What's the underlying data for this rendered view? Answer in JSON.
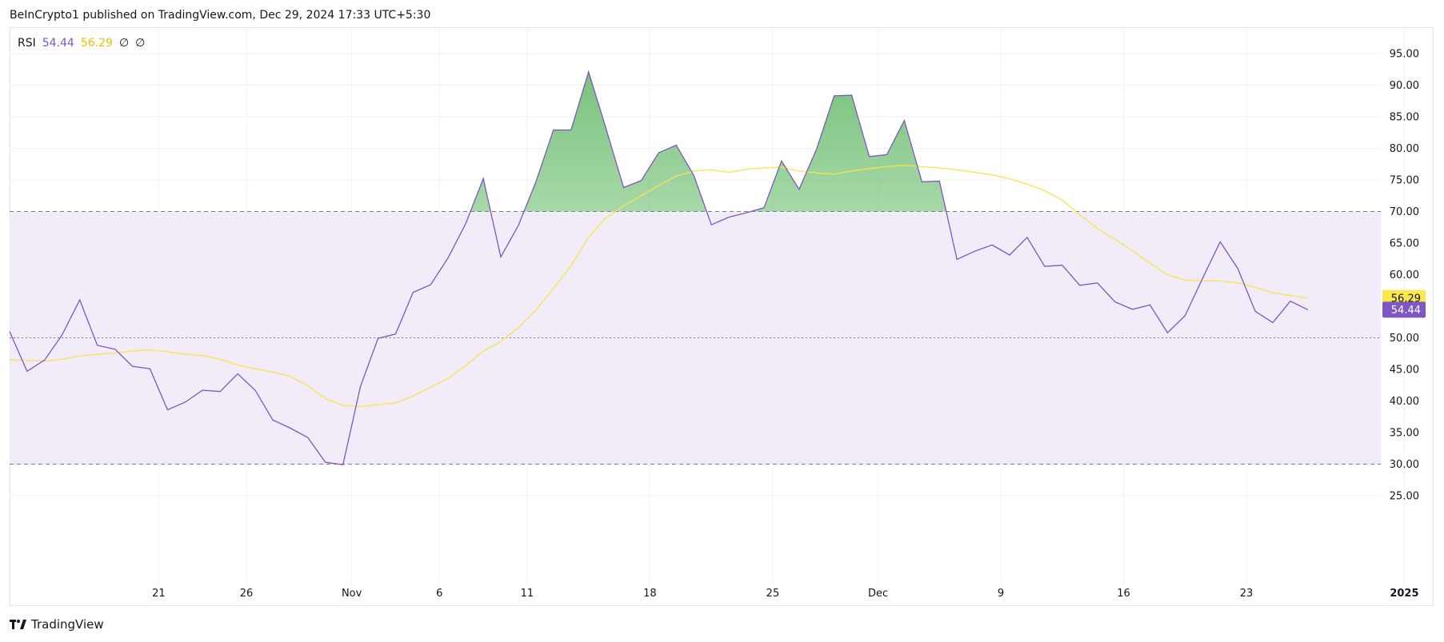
{
  "header": {
    "publisher": "BeInCrypto1 published on TradingView.com, Dec 29, 2024 17:33 UTC+5:30"
  },
  "legend": {
    "name": "RSI",
    "rsi_value": "54.44",
    "ma_value": "56.29",
    "na1": "∅",
    "na2": "∅"
  },
  "footer": {
    "logo_icon": "tradingview-logo-icon",
    "brand": "TradingView"
  },
  "colors": {
    "rsi": "#7e57c2",
    "ma": "#f7e44f",
    "band": "#ede7f6",
    "overbought": "#4caf50",
    "grid": "#f0f3fa"
  },
  "chart_data": {
    "type": "line",
    "y_ticks": [
      "95.00",
      "90.00",
      "85.00",
      "80.00",
      "75.00",
      "70.00",
      "65.00",
      "60.00",
      "55.00",
      "50.00",
      "45.00",
      "40.00",
      "35.00",
      "30.00",
      "25.00"
    ],
    "ylim": [
      23,
      98
    ],
    "bands": {
      "upper": 70,
      "middle": 50,
      "lower": 30
    },
    "x_ticks": [
      {
        "label": "21",
        "i": 8.5
      },
      {
        "label": "26",
        "i": 13.5
      },
      {
        "label": "Nov",
        "i": 19.5
      },
      {
        "label": "6",
        "i": 24.5
      },
      {
        "label": "11",
        "i": 29.5
      },
      {
        "label": "18",
        "i": 36.5
      },
      {
        "label": "25",
        "i": 43.5
      },
      {
        "label": "Dec",
        "i": 49.5
      },
      {
        "label": "9",
        "i": 56.5
      },
      {
        "label": "16",
        "i": 63.5
      },
      {
        "label": "23",
        "i": 70.5
      },
      {
        "label": "2025",
        "i": 79.5
      }
    ],
    "series": [
      {
        "name": "RSI",
        "values": [
          51,
          44.7,
          46.5,
          50.5,
          56,
          48.8,
          48.2,
          45.5,
          45.1,
          38.6,
          39.8,
          41.7,
          41.5,
          44.3,
          41.7,
          37,
          35.7,
          34.2,
          30.3,
          29.9,
          42.3,
          49.9,
          50.6,
          57.2,
          58.4,
          62.7,
          68.1,
          75.2,
          62.8,
          67.8,
          74.7,
          82.9,
          82.9,
          92.1,
          83.1,
          73.8,
          74.9,
          79.3,
          80.5,
          75.7,
          67.9,
          69.1,
          69.8,
          70.6,
          78,
          73.5,
          79.9,
          88.3,
          88.4,
          78.7,
          79,
          84.4,
          74.7,
          74.8,
          62.4,
          63.7,
          64.7,
          63.1,
          65.9,
          61.3,
          61.5,
          58.3,
          58.7,
          55.7,
          54.5,
          55.2,
          50.8,
          53.5,
          59.4,
          65.2,
          61,
          54.2,
          52.4,
          55.8,
          54.44
        ]
      },
      {
        "name": "RSI-based MA",
        "values": [
          46.5,
          46.4,
          46.3,
          46.6,
          47.1,
          47.4,
          47.6,
          47.9,
          48.1,
          47.8,
          47.4,
          47.2,
          46.6,
          45.7,
          45.1,
          44.6,
          43.9,
          42.4,
          40.4,
          39.3,
          39.1,
          39.4,
          39.7,
          40.8,
          42.2,
          43.6,
          45.6,
          47.9,
          49.4,
          51.6,
          54.4,
          57.8,
          61.4,
          65.9,
          69,
          70.9,
          72.5,
          74.1,
          75.6,
          76.4,
          76.6,
          76.2,
          76.7,
          76.9,
          77,
          76.4,
          76.1,
          75.9,
          76.4,
          76.8,
          77.1,
          77.3,
          77.1,
          76.9,
          76.6,
          76.2,
          75.8,
          75.2,
          74.3,
          73.3,
          71.8,
          69.5,
          67.3,
          65.6,
          63.8,
          61.8,
          60,
          59.1,
          59,
          59,
          58.7,
          58,
          57.1,
          56.7,
          56.29
        ]
      }
    ]
  }
}
